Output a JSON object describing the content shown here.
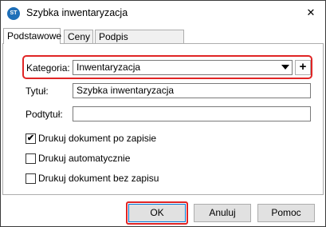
{
  "window": {
    "title": "Szybka inwentaryzacja",
    "icon_name": "app-icon",
    "icon_text": "ST",
    "close_icon": "close-icon",
    "close_glyph": "✕"
  },
  "tabs": [
    {
      "label": "Podstawowe",
      "active": true
    },
    {
      "label": "Ceny",
      "active": false
    },
    {
      "label": "Podpis elektroniczny",
      "active": false
    }
  ],
  "form": {
    "category": {
      "label": "Kategoria:",
      "value": "Inwentaryzacja",
      "add_glyph": "+"
    },
    "title": {
      "label": "Tytuł:",
      "value": "Szybka inwentaryzacja"
    },
    "subtitle": {
      "label": "Podtytuł:",
      "value": ""
    },
    "checkboxes": [
      {
        "label": "Drukuj dokument po zapisie",
        "checked": true,
        "mark": "✔"
      },
      {
        "label": "Drukuj automatycznie",
        "checked": false,
        "mark": ""
      },
      {
        "label": "Drukuj dokument bez zapisu",
        "checked": false,
        "mark": ""
      }
    ]
  },
  "buttons": {
    "ok": "OK",
    "cancel": "Anuluj",
    "help": "Pomoc"
  },
  "colors": {
    "highlight": "#e02525",
    "app_icon": "#1e6fb8"
  }
}
